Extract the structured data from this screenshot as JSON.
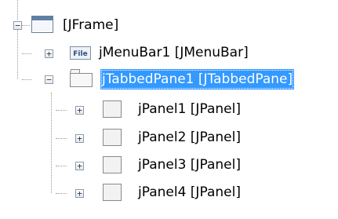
{
  "tree": {
    "root": {
      "label": "[JFrame]",
      "icon": "frame-icon",
      "expander": "−"
    },
    "nodes": [
      {
        "label": "jMenuBar1 [JMenuBar]",
        "icon": "menubar-file-icon",
        "icon_text": "File",
        "expander": "+"
      },
      {
        "label": "jTabbedPane1 [JTabbedPane]",
        "icon": "tabbed-pane-icon",
        "expander": "−",
        "selected": true
      },
      {
        "label": "jPanel1 [JPanel]",
        "icon": "panel-icon",
        "expander": "+"
      },
      {
        "label": "jPanel2 [JPanel]",
        "icon": "panel-icon",
        "expander": "+"
      },
      {
        "label": "jPanel3 [JPanel]",
        "icon": "panel-icon",
        "expander": "+"
      },
      {
        "label": "jPanel4 [JPanel]",
        "icon": "panel-icon",
        "expander": "+"
      }
    ]
  },
  "colors": {
    "selection": "#3399ff",
    "tree_line": "#9a9a9a",
    "icon_border": "#7f8fa3"
  }
}
